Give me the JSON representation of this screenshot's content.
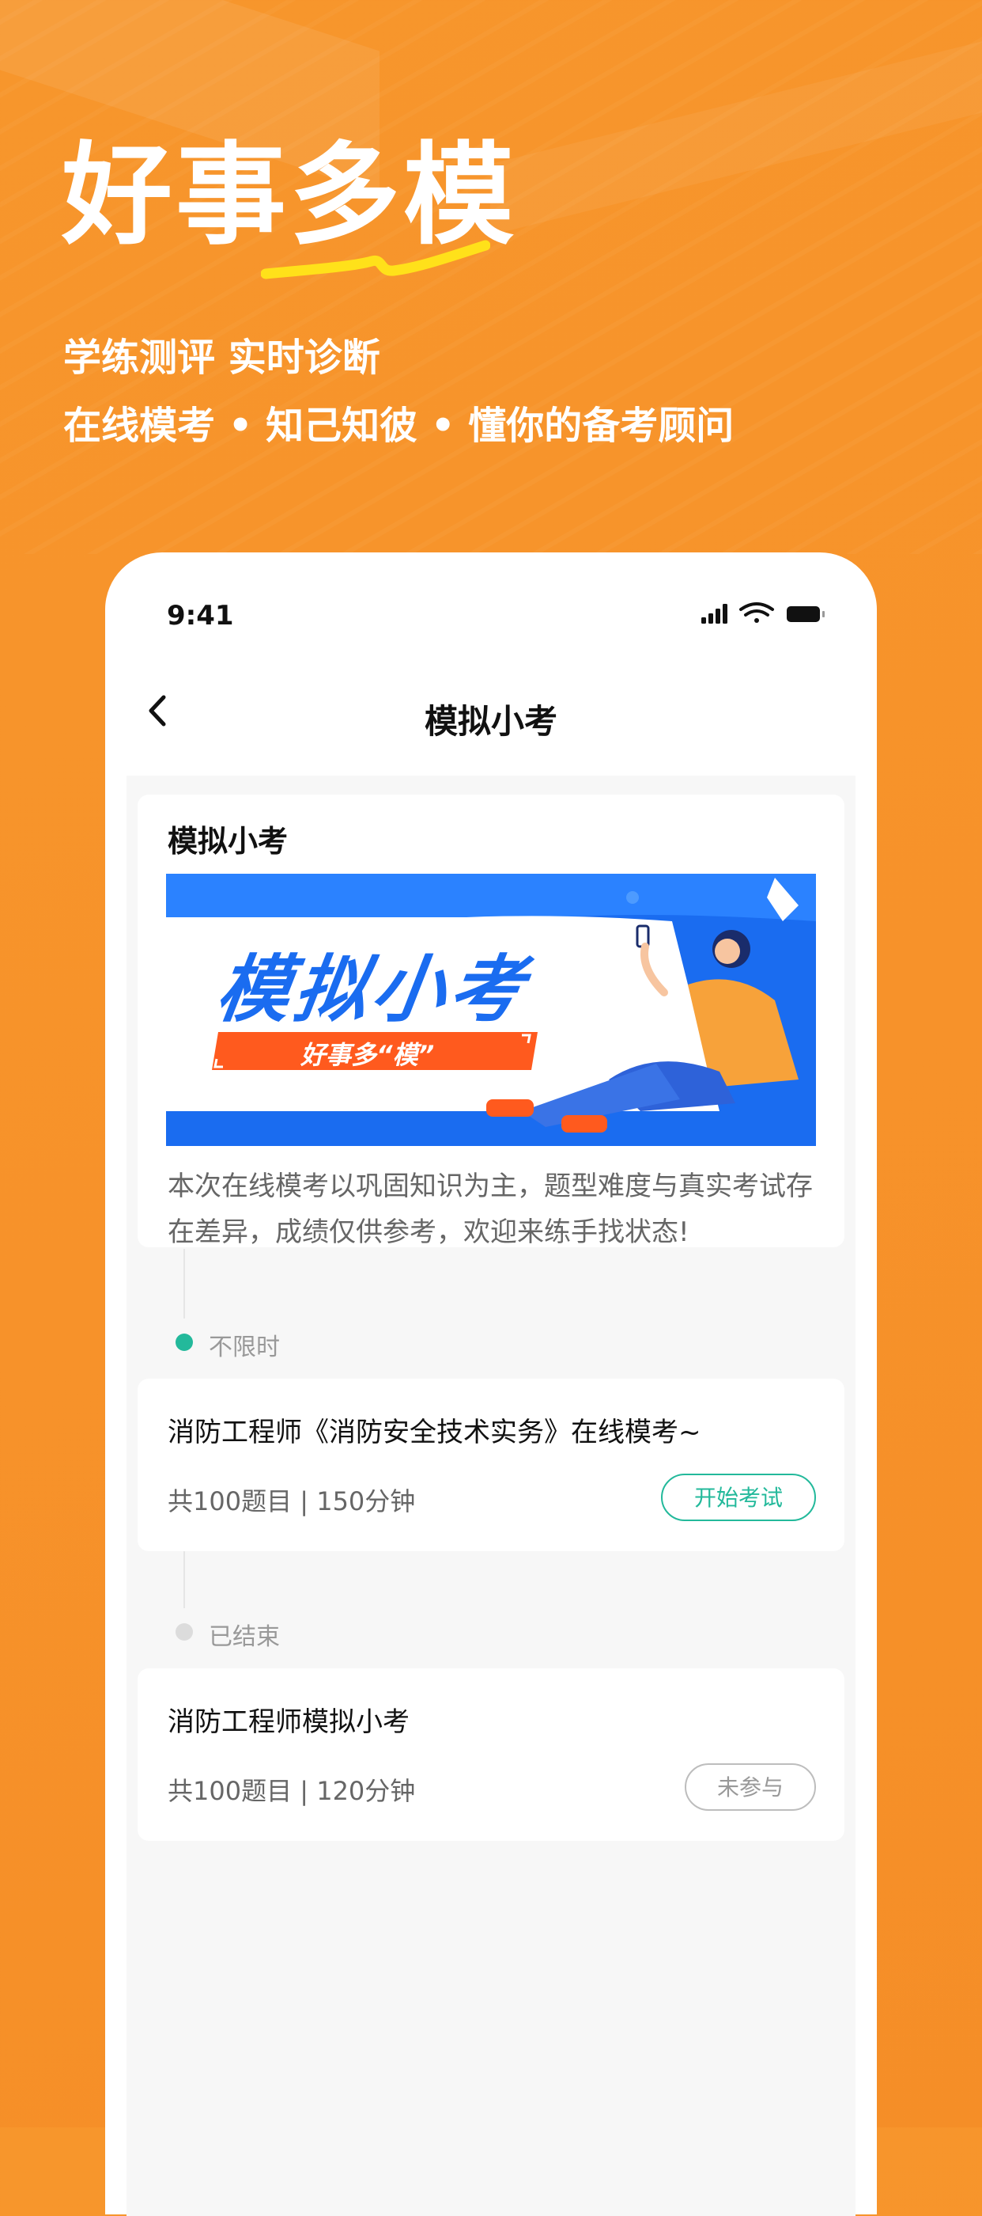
{
  "hero": {
    "title": "好事多模",
    "subtitle_line1": "学练测评 实时诊断",
    "subtitle_line2": "在线模考 • 知己知彼 • 懂你的备考顾问"
  },
  "status_bar": {
    "time": "9:41"
  },
  "nav": {
    "title": "模拟小考"
  },
  "intro_card": {
    "title": "模拟小考",
    "banner_title": "模拟小考",
    "banner_tag": "好事多“模”",
    "description": "本次在线模考以巩固知识为主，题型难度与真实考试存在差异，成绩仅供参考，欢迎来练手找状态!"
  },
  "sections": [
    {
      "status": "不限时",
      "status_color": "#23b99b",
      "exam": {
        "title": "消防工程师《消防安全技术实务》在线模考~",
        "meta": "共100题目 | 150分钟",
        "action": "开始考试"
      }
    },
    {
      "status": "已结束",
      "status_color": "#dcdcdc",
      "exam": {
        "title": "消防工程师模拟小考",
        "meta": "共100题目 | 120分钟",
        "action": "未参与"
      }
    }
  ],
  "colors": {
    "background": "#f7932b",
    "accent_green": "#23b99b",
    "banner_blue": "#1a6cf0",
    "banner_tag": "#ff5a1e"
  },
  "icons": [
    "back-arrow-icon",
    "signal-icon",
    "wifi-icon",
    "battery-icon",
    "underline-squiggle-icon"
  ]
}
